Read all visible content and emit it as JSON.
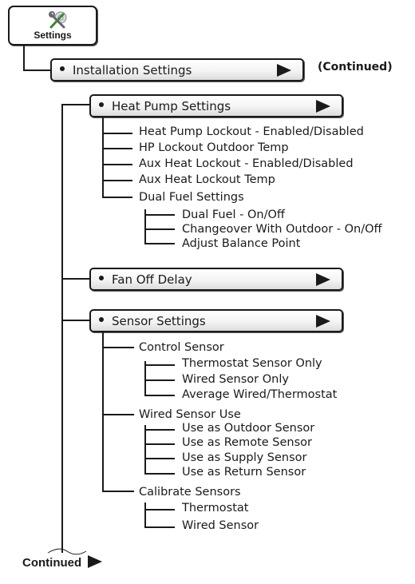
{
  "root": {
    "label": "Settings",
    "icon": "settings-tools-icon"
  },
  "continued_top": "(Continued)",
  "continued_bottom": "Continued",
  "installation": {
    "label": "Installation Settings"
  },
  "sections": [
    {
      "label": "Heat Pump Settings",
      "items": [
        {
          "label": "Heat Pump Lockout - Enabled/Disabled"
        },
        {
          "label": "HP Lockout Outdoor Temp"
        },
        {
          "label": "Aux Heat Lockout - Enabled/Disabled"
        },
        {
          "label": "Aux Heat Lockout Temp"
        },
        {
          "label": "Dual Fuel Settings",
          "children": [
            {
              "label": "Dual Fuel - On/Off"
            },
            {
              "label": "Changeover With Outdoor - On/Off"
            },
            {
              "label": "Adjust Balance Point"
            }
          ]
        }
      ]
    },
    {
      "label": "Fan Off Delay",
      "items": []
    },
    {
      "label": "Sensor Settings",
      "items": [
        {
          "label": "Control Sensor",
          "children": [
            {
              "label": "Thermostat Sensor Only"
            },
            {
              "label": "Wired Sensor Only"
            },
            {
              "label": "Average Wired/Thermostat"
            }
          ]
        },
        {
          "label": "Wired Sensor Use",
          "children": [
            {
              "label": "Use as Outdoor Sensor"
            },
            {
              "label": "Use as Remote Sensor"
            },
            {
              "label": "Use as Supply Sensor"
            },
            {
              "label": "Use as Return Sensor"
            }
          ]
        },
        {
          "label": "Calibrate Sensors",
          "children": [
            {
              "label": "Thermostat"
            },
            {
              "label": "Wired Sensor"
            }
          ]
        }
      ]
    }
  ]
}
